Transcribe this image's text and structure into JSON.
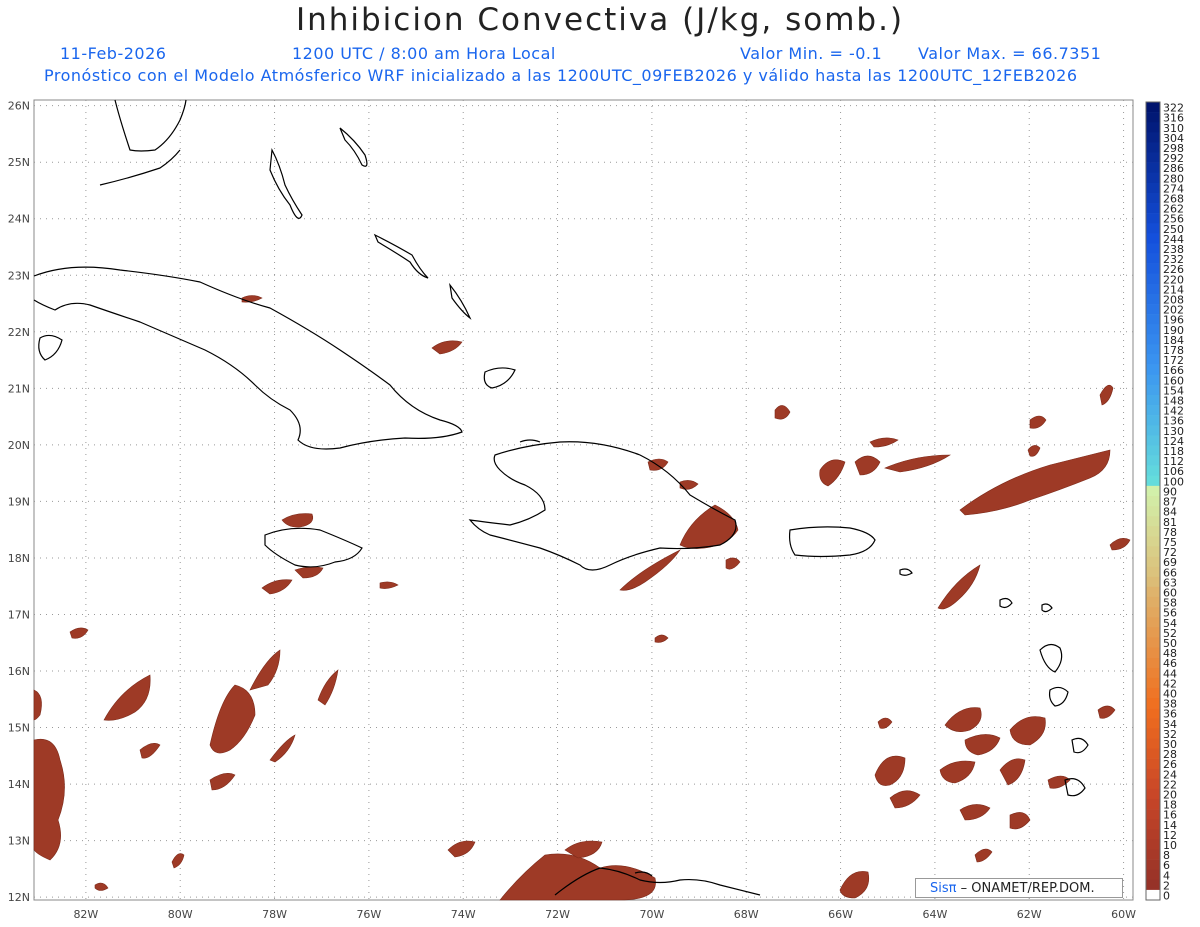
{
  "header": {
    "title": "Inhibicion Convectiva (J/kg, somb.)",
    "date": "11-Feb-2026",
    "time": "1200 UTC / 8:00 am Hora Local",
    "min_label": "Valor Min. = -0.1",
    "max_label": "Valor Max. = 66.7351",
    "forecast_line": "Pronóstico con el Modelo Atmósferico WRF inicializado a las 1200UTC_09FEB2026 y válido hasta las  1200UTC_12FEB2026"
  },
  "map": {
    "lon_labels": [
      "82W",
      "80W",
      "78W",
      "76W",
      "74W",
      "72W",
      "70W",
      "68W",
      "66W",
      "64W",
      "62W",
      "60W"
    ],
    "lat_labels": [
      "26N",
      "25N",
      "24N",
      "23N",
      "22N",
      "21N",
      "20N",
      "19N",
      "18N",
      "17N",
      "16N",
      "15N",
      "14N",
      "13N",
      "12N"
    ],
    "lon_range": [
      -83.1,
      -59.8
    ],
    "lat_range": [
      11.95,
      26.1
    ],
    "grid": true,
    "shading_color": "#9e3a26",
    "coastline_color": "#000000"
  },
  "colorbar": {
    "labels": [
      "322",
      "316",
      "310",
      "304",
      "298",
      "292",
      "286",
      "280",
      "274",
      "268",
      "262",
      "256",
      "250",
      "244",
      "238",
      "232",
      "226",
      "220",
      "214",
      "208",
      "202",
      "196",
      "190",
      "184",
      "178",
      "172",
      "166",
      "160",
      "154",
      "148",
      "142",
      "136",
      "130",
      "124",
      "118",
      "112",
      "106",
      "100",
      "90",
      "87",
      "84",
      "81",
      "78",
      "75",
      "72",
      "69",
      "66",
      "63",
      "60",
      "58",
      "56",
      "54",
      "52",
      "50",
      "48",
      "46",
      "44",
      "42",
      "40",
      "38",
      "36",
      "34",
      "32",
      "30",
      "28",
      "26",
      "24",
      "22",
      "20",
      "18",
      "16",
      "14",
      "12",
      "10",
      "8",
      "6",
      "4",
      "2",
      "0"
    ]
  },
  "credit": {
    "sis": "Sisπ",
    "org": "– ONAMET/REP.DOM."
  }
}
